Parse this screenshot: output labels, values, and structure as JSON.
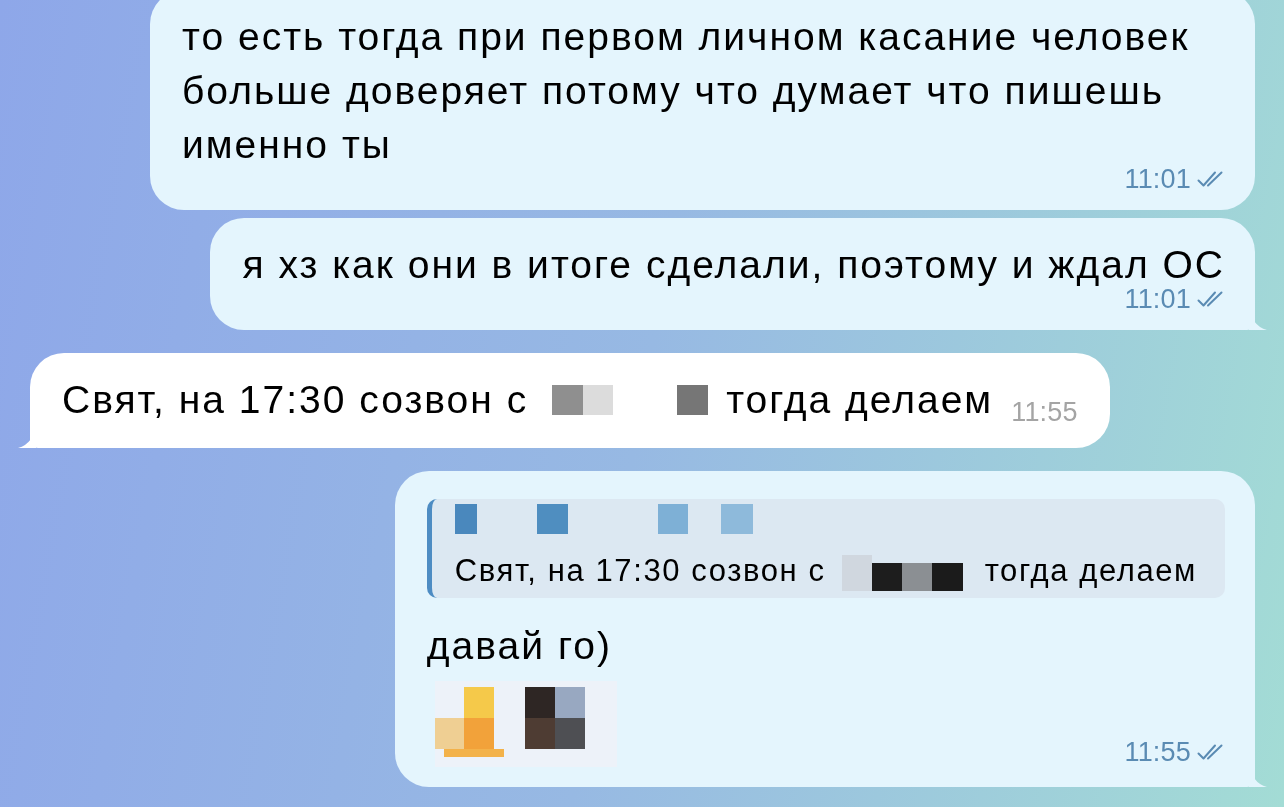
{
  "messages": [
    {
      "kind": "outgoing",
      "time": "11:01",
      "read": true,
      "paragraphs": [
        {
          "parts": [
            {
              "kind": "text",
              "text": "то есть тогда при первом личном касание человек больше доверяет потому что думает что пишешь именно ты"
            }
          ]
        }
      ]
    },
    {
      "kind": "outgoing",
      "time": "11:01",
      "read": true,
      "paragraphs": [
        {
          "parts": [
            {
              "kind": "text",
              "text": "я хз как они в итоге сделали, поэтому и ждал ОС"
            }
          ]
        }
      ]
    },
    {
      "kind": "incoming",
      "time": "11:55",
      "paragraphs": [
        {
          "parts": [
            {
              "kind": "text",
              "text": "Свят, на 17:30 созвон с"
            },
            {
              "kind": "redacted"
            },
            {
              "kind": "text",
              "text": "тогда делаем"
            }
          ]
        }
      ]
    },
    {
      "kind": "outgoing",
      "time": "11:55",
      "read": true,
      "reply": {
        "sender": {
          "kind": "redacted"
        },
        "parts": [
          {
            "kind": "text",
            "text": "Свят, на 17:30 созвон с"
          },
          {
            "kind": "redacted"
          },
          {
            "kind": "text",
            "text": "тогда делаем"
          }
        ]
      },
      "paragraphs": [
        {
          "parts": [
            {
              "kind": "text",
              "text": "давай го)"
            }
          ]
        },
        {
          "parts": [
            {
              "kind": "redacted"
            }
          ]
        }
      ]
    }
  ]
}
